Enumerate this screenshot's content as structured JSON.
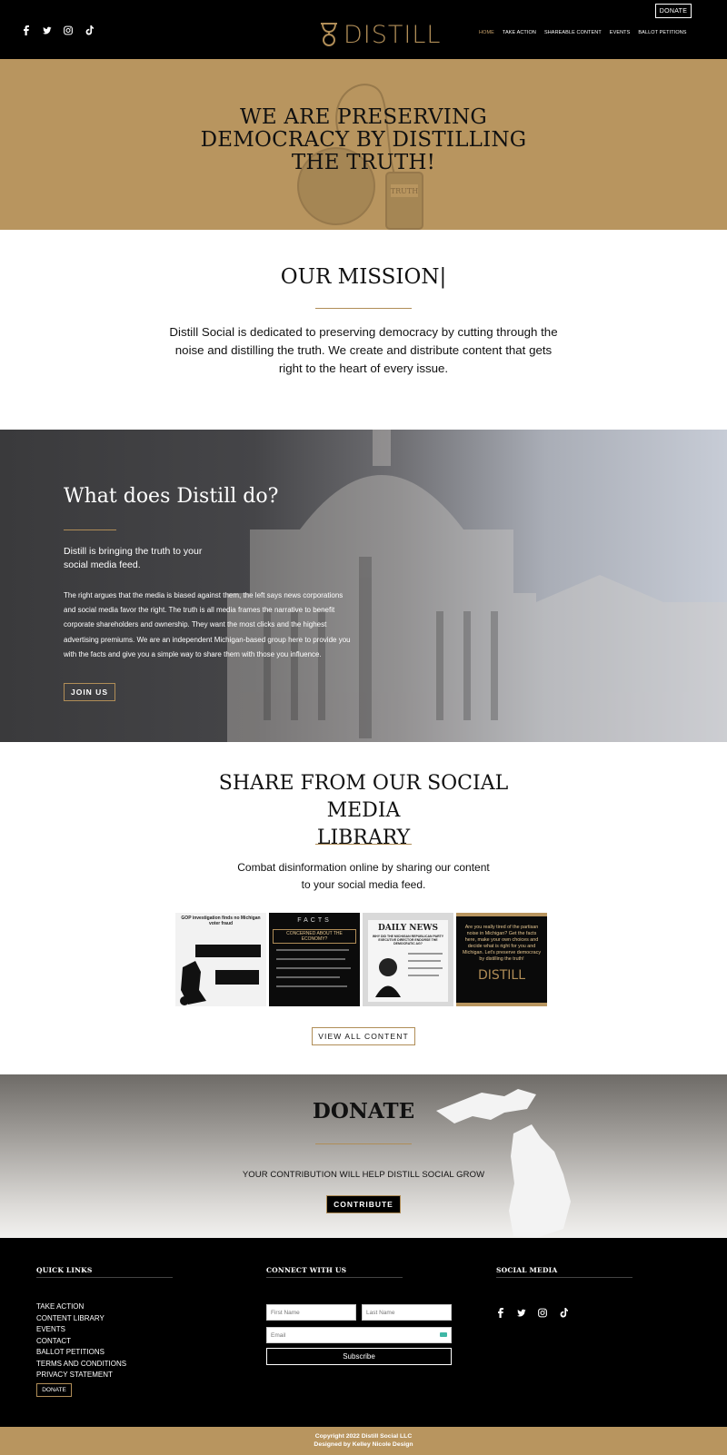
{
  "header": {
    "donate_label": "DONATE",
    "logo_text": "DISTILL",
    "social_icons": [
      "facebook-icon",
      "twitter-icon",
      "instagram-icon",
      "tiktok-icon"
    ],
    "nav": [
      {
        "label": "HOME",
        "active": true
      },
      {
        "label": "TAKE ACTION",
        "active": false
      },
      {
        "label": "SHAREABLE CONTENT",
        "active": false
      },
      {
        "label": "EVENTS",
        "active": false
      },
      {
        "label": "BALLOT PETITIONS",
        "active": false
      }
    ]
  },
  "hero": {
    "title_line1": "WE ARE PRESERVING",
    "title_line2": "DEMOCRACY BY DISTILLING",
    "title_line3": "THE TRUTH!",
    "art_bottle_label": "TRUTH"
  },
  "mission": {
    "title": "OUR MISSION|",
    "text": "Distill Social is dedicated to preserving democracy by cutting through the noise and distilling the truth. We create and distribute content that gets right to the heart of every issue."
  },
  "what": {
    "title": "What does Distill do?",
    "subtitle": "Distill is bringing the truth to your social media feed.",
    "body": "The right argues that the media is biased against them, the left says news corporations and social media favor the right. The truth is all media frames the narrative to benefit corporate shareholders and ownership. They want the most clicks and the highest advertising premiums. We are an independent Michigan-based group here to provide you with the facts and give you a simple way to share them with those you influence.",
    "join_label": "JOIN US"
  },
  "library": {
    "title_line1": "SHARE FROM OUR SOCIAL MEDIA",
    "title_line2": "LIBRARY",
    "subtitle_line1": "Combat disinformation online by sharing our content",
    "subtitle_line2": "to your social media feed.",
    "tiles": {
      "tile1_headline": "GOP investigation finds no Michigan voter fraud",
      "tile2_banner": "FACTS",
      "tile2_title": "CONCERNED ABOUT THE ECONOMY?",
      "tile3_masthead": "DAILY NEWS",
      "tile3_headline": "WHY DID THE MICHIGAN REPUBLICAN PARTY EXECUTIVE DIRECTOR ENDORSE THE DEMOCRATIC AG?",
      "tile4_text": "Are you really tired of the partisan noise in Michigan? Get the facts here, make your own choices and decide what is right for you and Michigan. Let's preserve democracy by distilling the truth!",
      "tile4_logo": "DISTILL"
    },
    "view_all_label": "VIEW ALL CONTENT"
  },
  "donate": {
    "title": "DONATE",
    "subtitle": "YOUR CONTRIBUTION WILL HELP DISTILL SOCIAL GROW",
    "button_label": "CONTRIBUTE"
  },
  "footer": {
    "quick_links_heading": "QUICK LINKS",
    "quick_links": [
      "TAKE ACTION",
      "CONTENT LIBRARY",
      "EVENTS",
      "CONTACT",
      "BALLOT PETITIONS",
      "TERMS AND CONDITIONS",
      "PRIVACY STATEMENT"
    ],
    "donate_label": "DONATE",
    "connect_heading": "CONNECT WITH US",
    "first_name_placeholder": "First Name",
    "last_name_placeholder": "Last Name",
    "email_placeholder": "Email",
    "subscribe_label": "Subscribe",
    "social_heading": "SOCIAL MEDIA",
    "copyright_line1": "Copyright 2022 Distill Social LLC",
    "copyright_line2": "Designed by Kelley Nicole Design"
  },
  "colors": {
    "gold": "#b8955f",
    "accent_gold": "#b08d57",
    "black": "#000000"
  }
}
